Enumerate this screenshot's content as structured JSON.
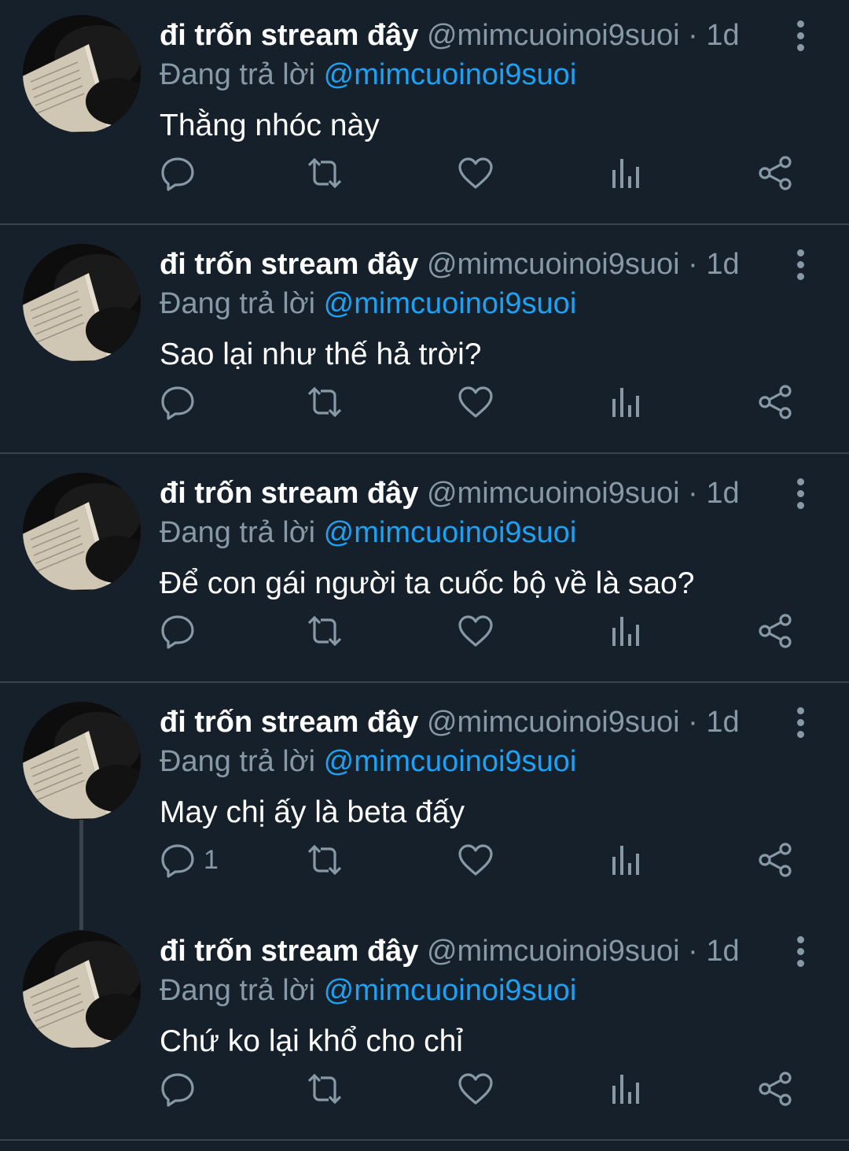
{
  "colors": {
    "background": "#15202b",
    "divider": "#38444d",
    "secondary_text": "#8899a6",
    "mention": "#1da1f2",
    "primary_text": "#ffffff"
  },
  "tweets": [
    {
      "display_name": "đi trốn stream đây",
      "handle": "@mimcuoinoi9suoi",
      "separator": "·",
      "time": "1d",
      "replying_label": "Đang trả lời",
      "replying_to": "@mimcuoinoi9suoi",
      "text": "Thằng nhóc này",
      "reply_count": ""
    },
    {
      "display_name": "đi trốn stream đây",
      "handle": "@mimcuoinoi9suoi",
      "separator": "·",
      "time": "1d",
      "replying_label": "Đang trả lời",
      "replying_to": "@mimcuoinoi9suoi",
      "text": "Sao lại như thế hả trời?",
      "reply_count": ""
    },
    {
      "display_name": "đi trốn stream đây",
      "handle": "@mimcuoinoi9suoi",
      "separator": "·",
      "time": "1d",
      "replying_label": "Đang trả lời",
      "replying_to": "@mimcuoinoi9suoi",
      "text": "Để con gái người ta cuốc bộ về là sao?",
      "reply_count": ""
    },
    {
      "display_name": "đi trốn stream đây",
      "handle": "@mimcuoinoi9suoi",
      "separator": "·",
      "time": "1d",
      "replying_label": "Đang trả lời",
      "replying_to": "@mimcuoinoi9suoi",
      "text": "May chị ấy là beta đấy",
      "reply_count": "1"
    },
    {
      "display_name": "đi trốn stream đây",
      "handle": "@mimcuoinoi9suoi",
      "separator": "·",
      "time": "1d",
      "replying_label": "Đang trả lời",
      "replying_to": "@mimcuoinoi9suoi",
      "text": "Chứ ko lại khổ cho chỉ",
      "reply_count": ""
    }
  ],
  "icons": {
    "avatar": "black-cat-with-book-avatar",
    "more": "more-vertical-icon",
    "reply": "reply-icon",
    "retweet": "retweet-icon",
    "like": "heart-icon",
    "analytics": "analytics-icon",
    "share": "share-icon"
  }
}
